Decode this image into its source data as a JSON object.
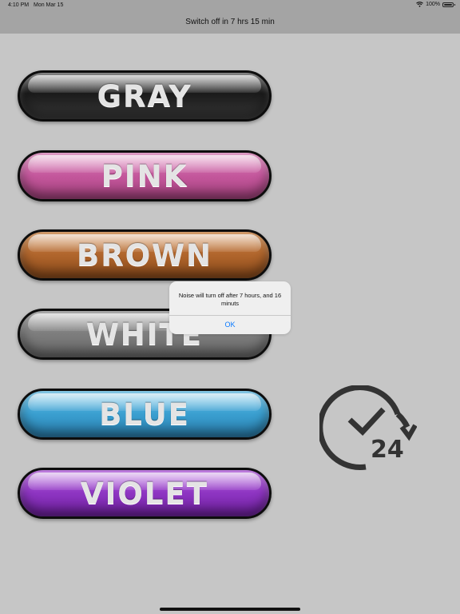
{
  "status_bar": {
    "time": "4:10 PM",
    "date": "Mon Mar 15",
    "battery": "100%",
    "icons": [
      "wifi-icon",
      "battery-icon"
    ]
  },
  "nav": {
    "title": "Switch off in 7 hrs 15 min"
  },
  "noise_buttons": [
    {
      "label": "GRAY",
      "color": "#2b2b2b"
    },
    {
      "label": "PINK",
      "color": "#c4579c"
    },
    {
      "label": "BROWN",
      "color": "#b0652c"
    },
    {
      "label": "WHITE",
      "color": "#7d7d7d"
    },
    {
      "label": "BLUE",
      "color": "#3a9fd0"
    },
    {
      "label": "VIOLET",
      "color": "#8e35c2"
    }
  ],
  "timer_icon": {
    "icon": "clock-24-icon",
    "label": "24"
  },
  "alert": {
    "message": "Noise will turn off after 7 hours, and 16 minuts",
    "ok_label": "OK",
    "ok_color": "#0a7aff"
  }
}
